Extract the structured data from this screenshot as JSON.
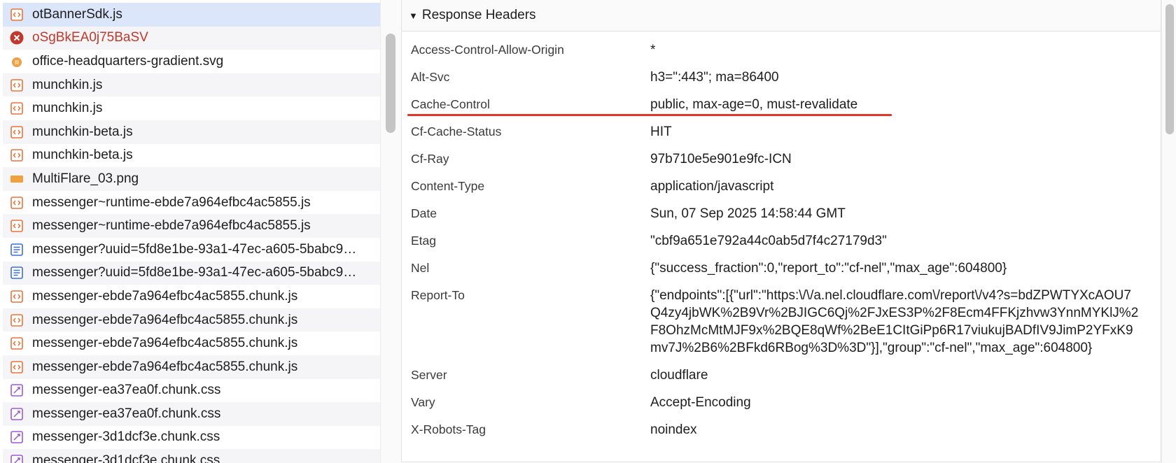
{
  "file_list": {
    "items": [
      {
        "name": "otBannerSdk.js",
        "icon": "script-icon",
        "state": "selected"
      },
      {
        "name": "oSgBkEA0j75BaSV",
        "icon": "error-icon",
        "state": "error"
      },
      {
        "name": "office-headquarters-gradient.svg",
        "icon": "svg-image-icon",
        "state": "normal"
      },
      {
        "name": "munchkin.js",
        "icon": "script-icon",
        "state": "normal"
      },
      {
        "name": "munchkin.js",
        "icon": "script-icon",
        "state": "normal"
      },
      {
        "name": "munchkin-beta.js",
        "icon": "script-icon",
        "state": "normal"
      },
      {
        "name": "munchkin-beta.js",
        "icon": "script-icon",
        "state": "normal"
      },
      {
        "name": "MultiFlare_03.png",
        "icon": "image-icon",
        "state": "normal"
      },
      {
        "name": "messenger~runtime-ebde7a964efbc4ac5855.js",
        "icon": "script-icon",
        "state": "normal"
      },
      {
        "name": "messenger~runtime-ebde7a964efbc4ac5855.js",
        "icon": "script-icon",
        "state": "normal"
      },
      {
        "name": "messenger?uuid=5fd8e1be-93a1-47ec-a605-5babc9…",
        "icon": "document-icon",
        "state": "normal"
      },
      {
        "name": "messenger?uuid=5fd8e1be-93a1-47ec-a605-5babc9…",
        "icon": "document-icon",
        "state": "normal"
      },
      {
        "name": "messenger-ebde7a964efbc4ac5855.chunk.js",
        "icon": "script-icon",
        "state": "normal"
      },
      {
        "name": "messenger-ebde7a964efbc4ac5855.chunk.js",
        "icon": "script-icon",
        "state": "normal"
      },
      {
        "name": "messenger-ebde7a964efbc4ac5855.chunk.js",
        "icon": "script-icon",
        "state": "normal"
      },
      {
        "name": "messenger-ebde7a964efbc4ac5855.chunk.js",
        "icon": "script-icon",
        "state": "normal"
      },
      {
        "name": "messenger-ea37ea0f.chunk.css",
        "icon": "stylesheet-icon",
        "state": "normal"
      },
      {
        "name": "messenger-ea37ea0f.chunk.css",
        "icon": "stylesheet-icon",
        "state": "normal"
      },
      {
        "name": "messenger-3d1dcf3e.chunk.css",
        "icon": "stylesheet-icon",
        "state": "normal"
      },
      {
        "name": "messenger-3d1dcf3e.chunk.css",
        "icon": "stylesheet-icon",
        "state": "normal"
      }
    ]
  },
  "response_headers": {
    "title": "Response Headers",
    "rows": [
      {
        "key": "Access-Control-Allow-Origin",
        "value": "*"
      },
      {
        "key": "Alt-Svc",
        "value": "h3=\":443\"; ma=86400"
      },
      {
        "key": "Cache-Control",
        "value": "public, max-age=0, must-revalidate"
      },
      {
        "key": "Cf-Cache-Status",
        "value": "HIT"
      },
      {
        "key": "Cf-Ray",
        "value": "97b710e5e901e9fc-ICN"
      },
      {
        "key": "Content-Type",
        "value": "application/javascript"
      },
      {
        "key": "Date",
        "value": "Sun, 07 Sep 2025 14:58:44 GMT"
      },
      {
        "key": "Etag",
        "value": "\"cbf9a651e792a44c0ab5d7f4c27179d3\""
      },
      {
        "key": "Nel",
        "value": "{\"success_fraction\":0,\"report_to\":\"cf-nel\",\"max_age\":604800}"
      },
      {
        "key": "Report-To",
        "value": "{\"endpoints\":[{\"url\":\"https:\\/\\/a.nel.cloudflare.com\\/report\\/v4?s=bdZPWTYXcAOU7Q4zy4jbWK%2B9Vr%2BJIGC6Qj%2FJxES3P%2F8Ecm4FFKjzhvw3YnnMYKlJ%2F8OhzMcMtMJF9x%2BQE8qWf%2BeE1CItGiPp6R17viukujBADfIV9JimP2YFxK9mv7J%2B6%2BFkd6RBog%3D%3D\"}],\"group\":\"cf-nel\",\"max_age\":604800}"
      },
      {
        "key": "Server",
        "value": "cloudflare"
      },
      {
        "key": "Vary",
        "value": "Accept-Encoding"
      },
      {
        "key": "X-Robots-Tag",
        "value": "noindex"
      }
    ]
  },
  "colors": {
    "selected_row": "#dce6fb",
    "error_text": "#c0392b",
    "highlight_underline": "#e0362c",
    "script_icon": "#e8743b",
    "document_icon": "#3b6fd9",
    "stylesheet_icon": "#9b59d6"
  }
}
